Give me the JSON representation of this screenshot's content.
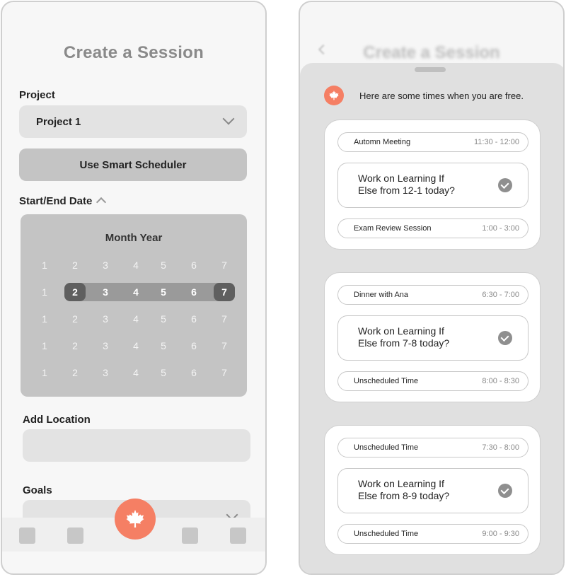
{
  "left_screen": {
    "title": "Create a Session",
    "project_label": "Project",
    "project_selected": "Project 1",
    "smart_scheduler_label": "Use Smart Scheduler",
    "date_label": "Start/End Date",
    "calendar": {
      "title": "Month Year",
      "rows": [
        [
          "1",
          "2",
          "3",
          "4",
          "5",
          "6",
          "7"
        ],
        [
          "1",
          "2",
          "3",
          "4",
          "5",
          "6",
          "7"
        ],
        [
          "1",
          "2",
          "3",
          "4",
          "5",
          "6",
          "7"
        ],
        [
          "1",
          "2",
          "3",
          "4",
          "5",
          "6",
          "7"
        ],
        [
          "1",
          "2",
          "3",
          "4",
          "5",
          "6",
          "7"
        ]
      ],
      "selected_range": {
        "row": 1,
        "start": "2",
        "end": "7"
      }
    },
    "location_label": "Add Location",
    "goals_label": "Goals",
    "fab_icon": "maple-leaf-icon",
    "accent_color": "#f57f64"
  },
  "right_screen": {
    "background_title": "Create a Session",
    "message": "Here are some times when you are free.",
    "cards": [
      {
        "before": {
          "name": "Automn Meeting",
          "time": "11:30 - 12:00"
        },
        "suggestion": [
          "Work on Learning If",
          "Else from 12-1 today?"
        ],
        "after": {
          "name": "Exam Review Session",
          "time": "1:00 - 3:00"
        }
      },
      {
        "before": {
          "name": "Dinner with Ana",
          "time": "6:30 - 7:00"
        },
        "suggestion": [
          "Work on Learning If",
          "Else from 7-8 today?"
        ],
        "after": {
          "name": "Unscheduled Time",
          "time": "8:00 - 8:30"
        }
      },
      {
        "before": {
          "name": "Unscheduled Time",
          "time": "7:30 - 8:00"
        },
        "suggestion": [
          "Work on Learning If",
          "Else from 8-9 today?"
        ],
        "after": {
          "name": "Unscheduled Time",
          "time": "9:00 - 9:30"
        }
      }
    ]
  }
}
